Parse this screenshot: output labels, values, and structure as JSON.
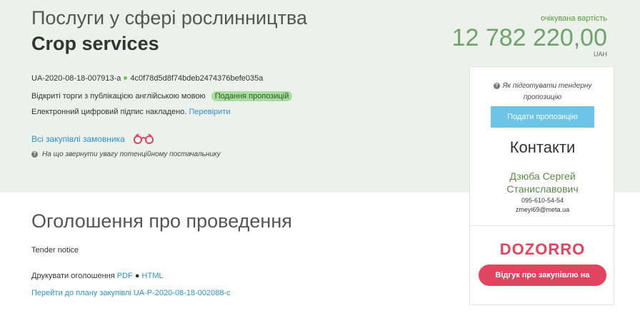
{
  "header": {
    "title_ua": "Послуги у сфері рослинництва",
    "title_en": "Crop services"
  },
  "tender": {
    "id": "UA-2020-08-18-007913-a",
    "hash": "4c0f78d5d8f74bdeb2474376befe035a",
    "type_text": "Відкриті торги з публікацією англійською мовою",
    "status_badge": "Подання пропозицій",
    "signature_text": "Електронний цифровий підпис накладено.",
    "verify_link": "Перевірити",
    "all_buyer_link": "Всі закупівлі замовника",
    "hint_text": "На що звернути увагу потенційному постачальнику"
  },
  "price": {
    "label": "очікувана вартість",
    "value": "12 782 220,00",
    "currency": "UAH"
  },
  "panel": {
    "hint_line1": "Як підготувати тендерну",
    "hint_line2": "пропозицію",
    "submit_label": "Подати пропозицію",
    "contacts_title": "Контакти",
    "contact_name_line1": "Дзюба Сергей",
    "contact_name_line2": "Станиславович",
    "phone": "095-610-54-54",
    "email": "zmeyi69@meta.ua",
    "dozorro_logo": "DOZORRO",
    "dozorro_button": "Відгук про закупівлю на Дозорро"
  },
  "notice": {
    "title": "Оголошення про проведення",
    "tender_notice": "Tender notice",
    "print_label": "Друкувати оголошення",
    "pdf_link": "PDF",
    "html_link": "HTML",
    "plan_link": "Перейти до плану закупівлі UA-P-2020-08-18-002088-c"
  },
  "icons": {
    "help": "question-circle-icon",
    "binoculars": "binoculars-icon"
  },
  "colors": {
    "band_bg": "#ecf1ec",
    "price_green": "#6ea36a",
    "link_blue": "#2d90cf",
    "submit_btn": "#6cc5e6",
    "dozorro_red": "#e0445f",
    "badge_green": "#a8dca0"
  }
}
